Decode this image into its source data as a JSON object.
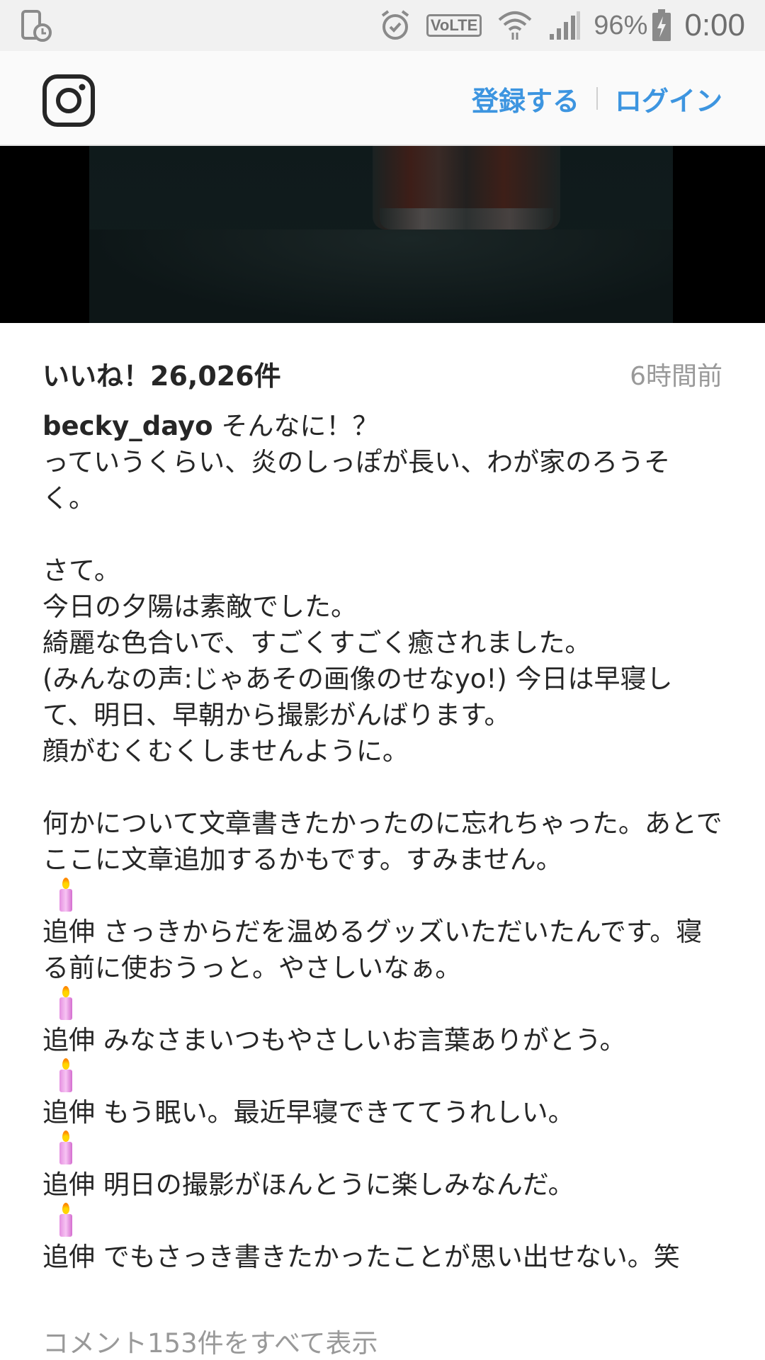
{
  "status_bar": {
    "battery": "96%",
    "clock": "0:00",
    "volte": "VoLTE",
    "icons": [
      "device-sync-icon",
      "alarm-icon",
      "volte-icon",
      "wifi-icon",
      "signal-icon",
      "battery-charging-icon"
    ]
  },
  "header": {
    "logo": "instagram-logo-icon",
    "signup_label": "登録する",
    "login_label": "ログイン",
    "link_color": "#3d95e0"
  },
  "post": {
    "likes": "いいね！26,026件",
    "time": "6時間前",
    "username": "becky_dayo",
    "caption_first": " そんなに！？\nっていうくらい、炎のしっぽが長い、わが家のろうそく。\n\nさて。\n今日の夕陽は素敵でした。\n綺麗な色合いで、すごくすごく癒されました。\n(みんなの声:じゃあその画像のせなyo!) 今日は早寝して、明日、早朝から撮影がんばります。\n顔がむくむくしませんように。\n\n何かについて文章書きたかったのに忘れちゃった。あとでここに文章追加するかもです。すみません。",
    "ps_lines": [
      "追伸 さっきからだを温めるグッズいただいたんです。寝る前に使おうっと。やさしいなぁ。",
      "追伸 みなさまいつもやさしいお言葉ありがとう。",
      "追伸 もう眠い。最近早寝できててうれしい。",
      "追伸 明日の撮影がほんとうに楽しみなんだ。",
      "追伸 でもさっき書きたかったことが思い出せない。笑"
    ],
    "view_comments": "コメント153件をすべて表示"
  }
}
